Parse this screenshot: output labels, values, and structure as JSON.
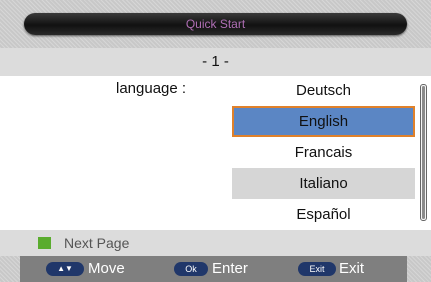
{
  "header": {
    "title": "Quick Start"
  },
  "page": {
    "indicator": "- 1 -"
  },
  "language": {
    "label": "language :",
    "options": [
      "Deutsch",
      "English",
      "Francais",
      "Italiano",
      "Español"
    ],
    "selected": "English"
  },
  "footer": {
    "next_page": "Next Page",
    "keys": [
      {
        "key": "▲▼",
        "label": "Move"
      },
      {
        "key": "Ok",
        "label": "Enter"
      },
      {
        "key": "Exit",
        "label": "Exit"
      }
    ]
  },
  "colors": {
    "selection_fill": "#5b86c4",
    "selection_border": "#e0812a",
    "title_text": "#b06fb5",
    "next_page_key": "#5aac2e",
    "key_badge": "#20376a"
  }
}
